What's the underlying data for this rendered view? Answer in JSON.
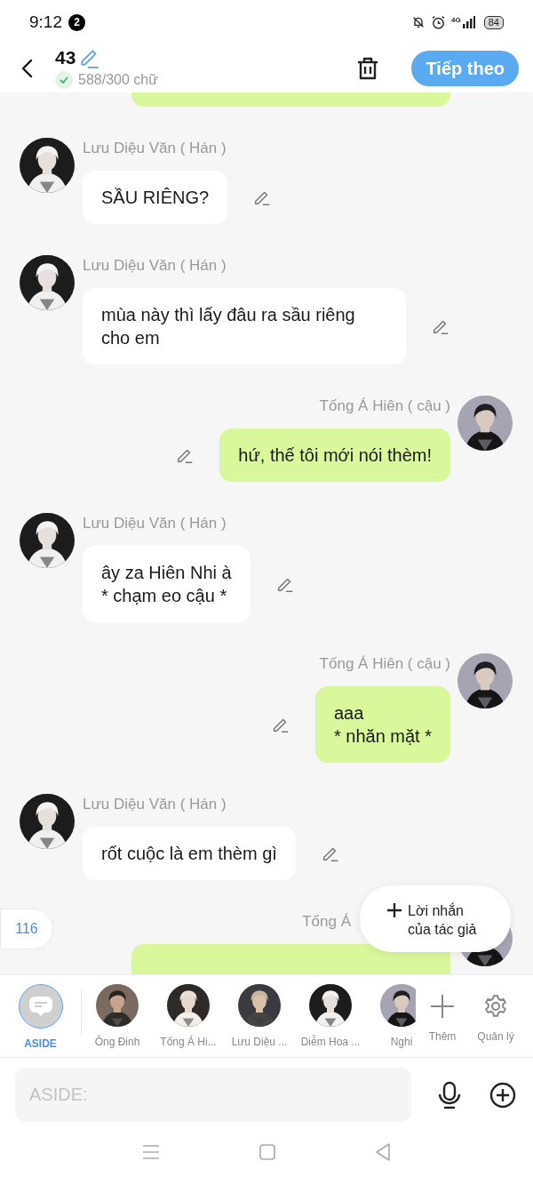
{
  "status_bar": {
    "time": "9:12",
    "notification_count": "2",
    "network": "4G",
    "battery": "84"
  },
  "header": {
    "title": "43",
    "word_count": "588/300 chữ",
    "next_button": "Tiếp theo"
  },
  "messages": [
    {
      "kind": "outgoing"
    },
    {
      "kind": "incoming",
      "name": "Lưu Diệu Văn ( Hán )",
      "text": "SẦU RIÊNG?"
    },
    {
      "kind": "incoming",
      "name": "Lưu Diệu Văn ( Hán )",
      "text": "mùa này thì lấy đâu ra sầu riêng cho em"
    },
    {
      "kind": "outgoing",
      "name": "Tống Á Hiên ( cậu )",
      "text": "hứ, thế tôi mới nói thèm!"
    },
    {
      "kind": "incoming",
      "name": "Lưu Diệu Văn ( Hán )",
      "text": "ây za Hiên Nhi à\n* chạm eo cậu *"
    },
    {
      "kind": "outgoing",
      "name": "Tống Á Hiên ( cậu )",
      "text": "aaa\n* nhăn mặt *"
    },
    {
      "kind": "incoming",
      "name": "Lưu Diệu Văn ( Hán )",
      "text": "rốt cuộc là em thèm gì"
    },
    {
      "kind": "outgoing",
      "name": "Tống Á"
    }
  ],
  "page_counter": "116",
  "author_note_button": "Lời nhắn của tác giả",
  "characters": [
    {
      "kind": "aside",
      "label": "ASIDE",
      "selected": true
    },
    {
      "kind": "character",
      "label": "Ông Đinh",
      "selected": false
    },
    {
      "kind": "character",
      "label": "Tống Á Hi...",
      "selected": false
    },
    {
      "kind": "character",
      "label": "Lưu Diệu ...",
      "selected": false
    },
    {
      "kind": "character",
      "label": "Diễm Hoa ...",
      "selected": false
    },
    {
      "kind": "character",
      "label": "Nghi",
      "selected": false
    }
  ],
  "actions": [
    {
      "kind": "add",
      "label": "Thêm"
    },
    {
      "kind": "manage",
      "label": "Quản lý"
    }
  ],
  "input": {
    "placeholder": "ASIDE:"
  }
}
